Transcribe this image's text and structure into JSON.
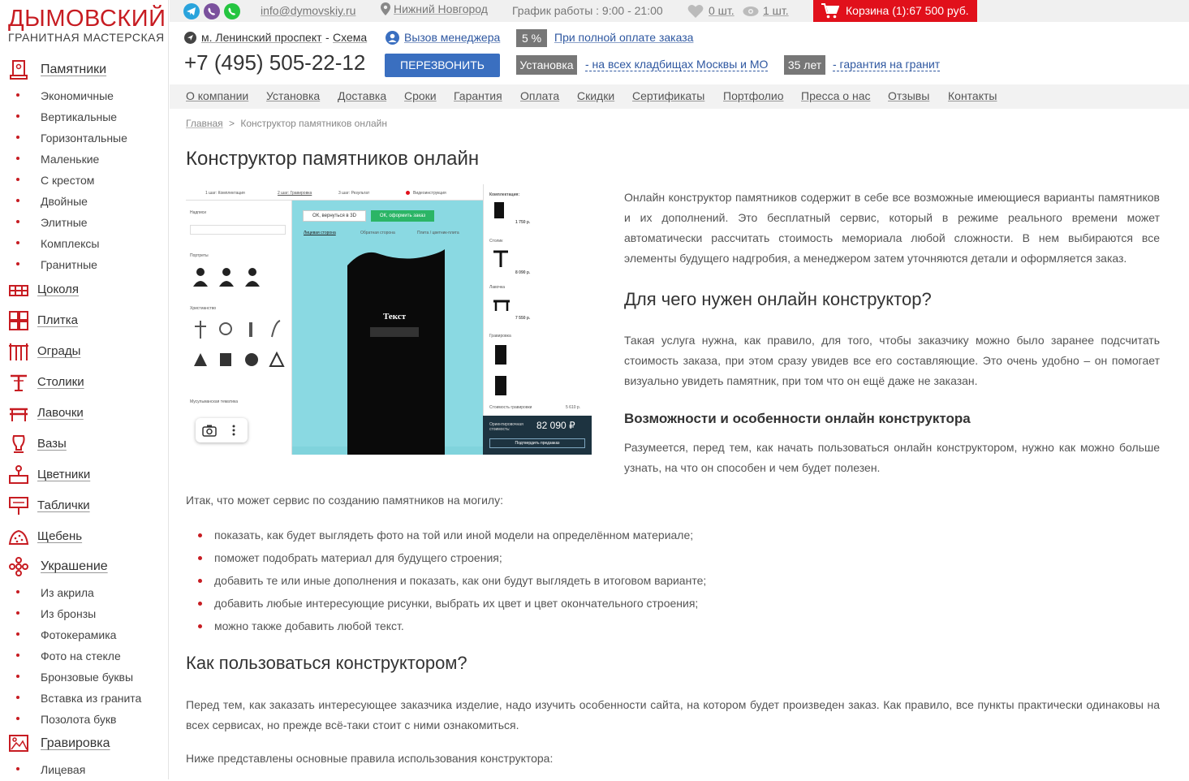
{
  "logo": {
    "title": "ДЫМОВСКИЙ",
    "subtitle": "ГРАНИТНАЯ МАСТЕРСКАЯ"
  },
  "sidebar": {
    "categories": [
      {
        "label": "Памятники",
        "icon": "monument-icon"
      },
      {
        "label": "Цоколя",
        "icon": "plinth-icon"
      },
      {
        "label": "Плитка",
        "icon": "tiles-icon"
      },
      {
        "label": "Ограды",
        "icon": "fence-icon"
      },
      {
        "label": "Столики",
        "icon": "table-icon"
      },
      {
        "label": "Лавочки",
        "icon": "bench-icon"
      },
      {
        "label": "Вазы",
        "icon": "vase-icon"
      },
      {
        "label": "Цветники",
        "icon": "flowerbed-icon"
      },
      {
        "label": "Таблички",
        "icon": "sign-icon"
      },
      {
        "label": "Щебень",
        "icon": "gravel-icon"
      },
      {
        "label": "Украшение",
        "icon": "flower-icon"
      },
      {
        "label": "Гравировка",
        "icon": "engraving-icon"
      }
    ],
    "monument_subs": [
      "Экономичные",
      "Вертикальные",
      "Горизонтальные",
      "Маленькие",
      "С крестом",
      "Двойные",
      "Элитные",
      "Комплексы",
      "Гранитные"
    ],
    "decor_subs": [
      "Из акрила",
      "Из бронзы",
      "Фотокерамика",
      "Фото на стекле",
      "Бронзовые буквы",
      "Вставка из гранита",
      "Позолота букв"
    ],
    "engraving_subs": [
      "Лицевая"
    ]
  },
  "topbar": {
    "email": "info@dymovskiy.ru",
    "city": "Нижний Новгород",
    "hours": "График работы : 9:00 - 21:00",
    "favorites": "0 шт.",
    "viewed": "1 шт.",
    "cart": "Корзина (1):67 500 руб.",
    "colors": {
      "cart": "#e1101b",
      "telegram": "#2aa3dc",
      "viber": "#7b519d",
      "whatsapp": "#25c540"
    }
  },
  "contact": {
    "metro": "м. Ленинский проспект",
    "scheme": "Схема",
    "manager": "Вызов менеджера",
    "discount_badge": "5 %",
    "discount_text": "При полной оплате заказа",
    "phone": "+7 (495) 505-22-12",
    "callback": "ПЕРЕЗВОНИТЬ",
    "install_badge": "Установка",
    "install_text": "- на всех кладбищах Москвы и МО",
    "years_badge": "35 лет",
    "years_text": "- гарантия на гранит"
  },
  "nav": [
    "О компании",
    "Установка",
    "Доставка",
    "Сроки",
    "Гарантия",
    "Оплата",
    "Скидки",
    "Сертификаты",
    "Портфолио",
    "Пресса о нас",
    "Отзывы",
    "Контакты"
  ],
  "breadcrumb": {
    "home": "Главная",
    "sep": ">",
    "current": "Конструктор памятников онлайн"
  },
  "page": {
    "title": "Конструктор памятников онлайн",
    "intro": "Онлайн конструктор памятников содержит в себе все возможные имеющиеся варианты памятников и их дополнений. Это бесплатный сервис, который в режиме реального времени может автоматически рассчитать стоимость мемориала любой сложности. В нем выбираются все элементы будущего надгробия, а менеджером затем уточняются детали и оформляется заказ.",
    "h2_why": "Для чего нужен онлайн конструктор?",
    "why_text": "Такая услуга нужна, как правило, для того, чтобы заказчику можно было заранее подсчитать стоимость заказа, при этом сразу увидев все его составляющие. Это очень удобно – он помогает визуально увидеть памятник, при том что он ещё даже не заказан.",
    "h3_features": "Возможности и особенности онлайн конструктора",
    "features_text": "Разумеется, перед тем, как начать пользоваться онлайн конструктором, нужно как можно больше узнать, на что он способен и чем будет полезен.",
    "list_intro": "Итак, что может сервис по созданию памятников на могилу:",
    "list": [
      "показать, как будет выглядеть фото на той или иной модели на определённом материале;",
      "поможет подобрать материал для будущего строения;",
      "добавить те или иные дополнения и показать, как они будут выглядеть в итоговом варианте;",
      "добавить любые интересующие рисунки, выбрать их цвет и цвет окончательного строения;",
      "можно также добавить любой текст."
    ],
    "h2_how": "Как пользоваться конструктором?",
    "how_text": "Перед тем, как заказать интересующее заказчика изделие, надо изучить особенности сайта, на котором будет произведен заказ. Как правило, все пункты практически одинаковы на всех сервисах, но прежде всё-таки стоит с ними ознакомиться.",
    "rules_intro": "Ниже представлены основные правила использования конструктора:"
  },
  "screenshot": {
    "step1": "1 шаг: Комплектация",
    "step2": "2 шаг: Гравировка",
    "step3": "3 шаг: Результат",
    "video": "Видеоинструкция",
    "inscriptions": "Надписи",
    "portraits": "Портреты",
    "christianity": "Христианство",
    "muslim": "Мусульманская тематика",
    "btn_back": "ОК, вернуться в 3D",
    "btn_order": "ОК, оформить заказ",
    "tab_front": "Лицевая сторона",
    "tab_back": "Обратная сторона",
    "tab_plate": "Плита / цветник-плита",
    "stone_text": "Текст",
    "complect": "Комплектация:",
    "table_label": "Столик",
    "bench_label": "Лавочка",
    "engraving_label": "Гравировка",
    "price1": "1 750 р.",
    "price2": "8 090 р.",
    "price3": "7 550 р.",
    "engr_cost_label": "Стоимость гравировки",
    "engr_cost": "5 610 р.",
    "total_label": "Ориентировочная стоимость:",
    "total": "82 090 ₽",
    "confirm": "Подтвердить предзаказ"
  }
}
